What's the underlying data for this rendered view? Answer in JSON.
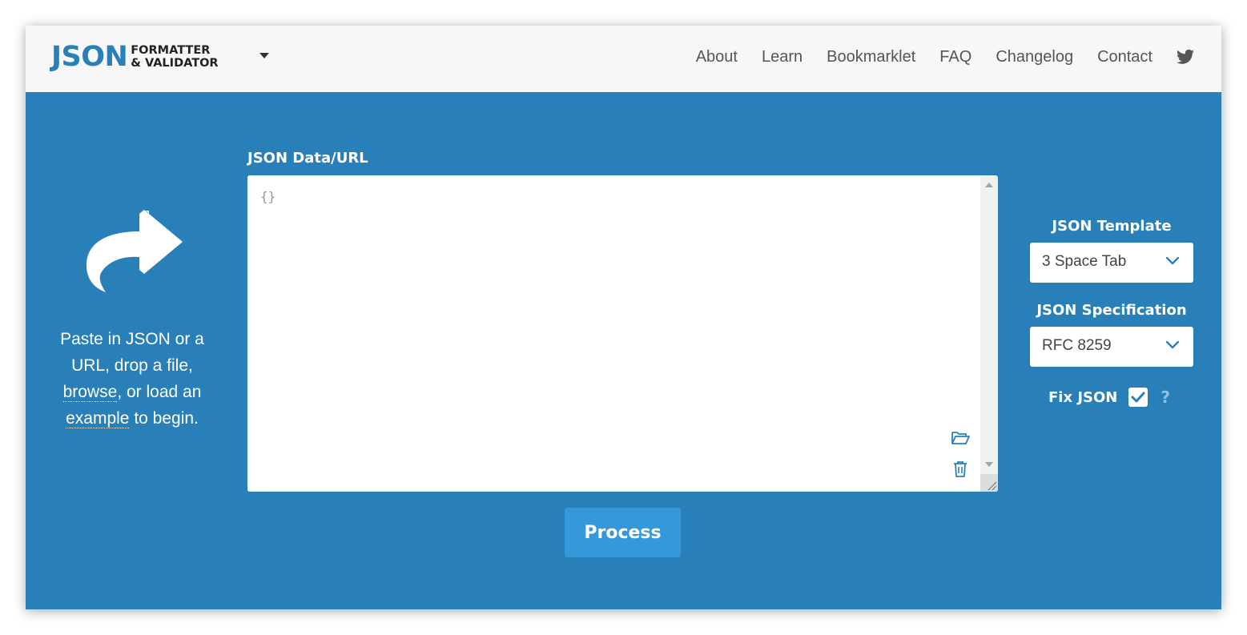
{
  "logo": {
    "main": "JSON",
    "sub_line1": "FORMATTER",
    "sub_line2": "& VALIDATOR"
  },
  "nav": {
    "items": [
      {
        "label": "About"
      },
      {
        "label": "Learn"
      },
      {
        "label": "Bookmarklet"
      },
      {
        "label": "FAQ"
      },
      {
        "label": "Changelog"
      },
      {
        "label": "Contact"
      }
    ],
    "social_icon": "twitter-icon"
  },
  "left_pane": {
    "icon": "share-arrow-icon",
    "text_part1": "Paste in JSON or a URL, drop a file, ",
    "browse_link": "browse",
    "text_part2": ", or load an ",
    "example_link": "example",
    "text_part3": " to begin."
  },
  "editor": {
    "label": "JSON Data/URL",
    "value": "",
    "placeholder": "{}",
    "open_file_icon": "folder-open-icon",
    "clear_icon": "trash-icon"
  },
  "process_button": "Process",
  "options": {
    "template_label": "JSON Template",
    "template_value": "3 Space Tab",
    "spec_label": "JSON Specification",
    "spec_value": "RFC 8259",
    "fix_label": "Fix JSON",
    "fix_checked": true,
    "help": "?"
  },
  "colors": {
    "brand_blue": "#2980b9",
    "button_blue": "#3498db",
    "header_bg": "#f7f7f7"
  }
}
